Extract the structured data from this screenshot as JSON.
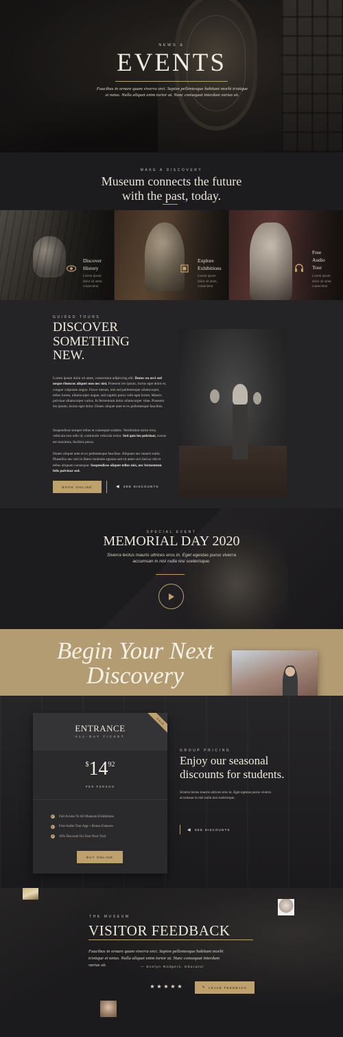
{
  "hero": {
    "eyebrow": "News &",
    "title": "EVENTS",
    "subtitle": "Faucibus in ornare quam viverra orci. Sapien pellentesque habitant morbi tristique et netus. Nulla aliquet enim tortor at. Nunc consequat interdum varius sit."
  },
  "intro": {
    "eyebrow": "Make a Discovery",
    "heading_line1": "Museum connects the future",
    "heading_line2": "with the past, today."
  },
  "tiles": [
    {
      "title_line1": "Discover",
      "title_line2": "History",
      "text_line1": "Lorem ipsum",
      "text_line2": "dolor sit amet,",
      "text_line3": "consectetur",
      "icon": "eye-icon"
    },
    {
      "title_line1": "Explore",
      "title_line2": "Exhibitions",
      "text_line1": "Lorem ipsum",
      "text_line2": "dolor sit amet,",
      "text_line3": "consectetur",
      "icon": "frame-icon"
    },
    {
      "title_line1": "Free",
      "title_line2": "Audio",
      "title_line3": "Tour",
      "text_line1": "Lorem ipsum",
      "text_line2": "dolor sit amet,",
      "text_line3": "consectetur",
      "icon": "headphones-icon"
    }
  ],
  "discover": {
    "eyebrow": "Guided Tours",
    "heading_line1": "DISCOVER",
    "heading_line2": "SOMETHING",
    "heading_line3": "NEW.",
    "p1_a": "Lorem ipsum dolor sit amet, consectetur adipiscing elit. ",
    "p1_b": "Donec eu orci sed neque rhoncus aliquet non nec nisi.",
    "p1_c": " Praesent leo ipsum, luctus eget dolor et, congue vulputate augue. Fusce rutrum, nisi sed pellentesque ullamcorper, tellus lorem, ullamcorper augue, sed sagittis purus velit eget lorem. Mauris pulvinar ullamcorper varius. In fermentum dolor ullamcorper vitae. Praesent leo ipsum, luctus eget dolor. Donec aliquet ante et ex pellentesque faucibus.",
    "p2_a": "Suspendisse semper tellus et consequat sodales. Vestibulum tortor eros, vehicula non odio id, commodo vehicula tortor. ",
    "p2_b": "Sed quis leo pulvinar,",
    "p2_c": " cursus est maximus, facilisis purus.",
    "p3_a": "Donec aliquet ante et ex pellentesque faucibus. Aliquam nec mauris nulla. Phasellus nec nisl in libero molestie egestas sed sit amet orci.Sed ac elit et tellus aliquam consequat. ",
    "p3_b": "Suspendisse aliquet tellus nisi, nec fermentum felis pulvinar sed.",
    "btn_primary": "Book Online",
    "btn_secondary": "See Discounts"
  },
  "memorial": {
    "eyebrow": "Special Event",
    "title": "MEMORIAL DAY 2020",
    "subtitle_line1": "Siverra lectus mauris ultrices eros in. Eget egestas purus viverra",
    "subtitle_line2": "accumsan in nisl nulla nisi scelerisque."
  },
  "band": {
    "title_line1": "Begin Your Next",
    "title_line2": "Discovery"
  },
  "ticket": {
    "ribbon": "Sale",
    "title": "ENTRANCE",
    "subtitle": "All-Day Ticket",
    "currency": "$",
    "price": "14",
    "cents": "92",
    "per": "Per Person",
    "features": [
      "Full Access To All Museum Exhibitions",
      "Free Audio Tour App + Bonus Features",
      "10% Discount On Your Next Visit"
    ],
    "button": "Buy Online"
  },
  "group": {
    "eyebrow": "Group Pricing",
    "heading_line1": "Enjoy our seasonal",
    "heading_line2": "discounts for students.",
    "text_line1": "Siverra lectus mauris ultrices eros in. Eget egestas purus viverra",
    "text_line2": "accumsan in nisl nulla nisi scelerisque.",
    "button": "See Discounts"
  },
  "feedback": {
    "eyebrow": "The Museum",
    "title": "VISITOR FEEDBACK",
    "quote_line1": "Faucibus in ornare quam viverra orci. Sapien pellentesque habitant morbi",
    "quote_line2": "tristique et netus. Nulla aliquet enim tortor at. Nunc consequat interdum",
    "quote_line3": "varius sit.",
    "author": "— Evelyn Rodgers, Educator",
    "rating": 5,
    "button": "Leave Feedback"
  },
  "colors": {
    "accent": "#bea16c",
    "band": "#b49c72",
    "dark": "#1c1b1d"
  }
}
